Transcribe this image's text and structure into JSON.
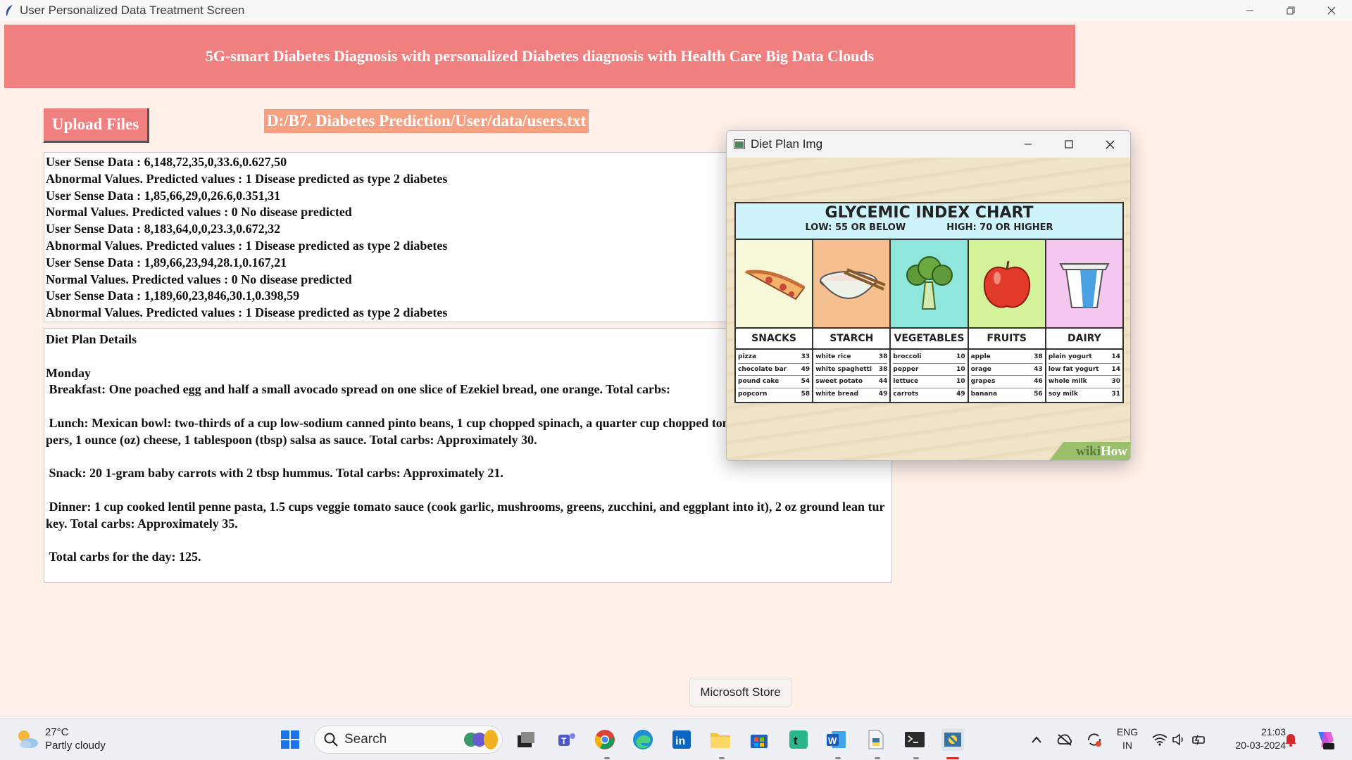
{
  "window": {
    "title": "User Personalized Data Treatment Screen"
  },
  "banner": {
    "title": "5G-smart  Diabetes Diagnosis with personalized Diabetes diagnosis with Health Care Big Data Clouds"
  },
  "upload": {
    "button_label": "Upload Files",
    "file_path": "D:/B7. Diabetes Prediction/User/data/users.txt"
  },
  "results": {
    "lines": [
      "User Sense Data : 6,148,72,35,0,33.6,0.627,50",
      "Abnormal Values. Predicted values : 1 Disease predicted as type 2 diabetes",
      "User Sense Data : 1,85,66,29,0,26.6,0.351,31",
      "Normal Values. Predicted values : 0 No disease predicted",
      "User Sense Data : 8,183,64,0,0,23.3,0.672,32",
      "Abnormal Values. Predicted values : 1 Disease predicted as type 2 diabetes",
      "User Sense Data : 1,89,66,23,94,28.1,0.167,21",
      "Normal Values. Predicted values : 0 No disease predicted",
      "User Sense Data : 1,189,60,23,846,30.1,0.398,59",
      "Abnormal Values. Predicted values : 1 Disease predicted as type 2 diabetes"
    ]
  },
  "diet": {
    "heading": "Diet Plan Details",
    "day": "Monday",
    "breakfast": " Breakfast: One poached egg and half a small avocado spread on one slice of Ezekiel bread, one orange. Total carbs:",
    "lunch": " Lunch: Mexican bowl: two-thirds of a cup low-sodium canned pinto beans, 1 cup chopped spinach, a quarter cup chopped tomatoes, a quarter cup bell peppers, 1 ounce (oz) cheese, 1 tablespoon (tbsp) salsa as sauce. Total carbs: Approximately 30.",
    "snack": " Snack: 20 1-gram baby carrots with 2 tbsp hummus. Total carbs: Approximately 21.",
    "dinner": " Dinner: 1 cup cooked lentil penne pasta, 1.5 cups veggie tomato sauce (cook garlic, mushrooms, greens, zucchini, and eggplant into it), 2 oz ground lean turkey. Total carbs: Approximately 35.",
    "total": " Total carbs for the day: 125."
  },
  "popup": {
    "title": "Diet Plan Img",
    "chart_title": "GLYCEMIC INDEX CHART",
    "low_label": "LOW: 55 OR BELOW",
    "high_label": "HIGH: 70 OR HIGHER",
    "categories": [
      {
        "name": "SNACKS",
        "items": [
          [
            "pizza",
            "33"
          ],
          [
            "chocolate bar",
            "49"
          ],
          [
            "pound cake",
            "54"
          ],
          [
            "popcorn",
            "58"
          ]
        ]
      },
      {
        "name": "STARCH",
        "items": [
          [
            "white rice",
            "38"
          ],
          [
            "white spaghetti",
            "38"
          ],
          [
            "sweet potato",
            "44"
          ],
          [
            "white bread",
            "49"
          ]
        ]
      },
      {
        "name": "VEGETABLES",
        "items": [
          [
            "broccoli",
            "10"
          ],
          [
            "pepper",
            "10"
          ],
          [
            "lettuce",
            "10"
          ],
          [
            "carrots",
            "49"
          ]
        ]
      },
      {
        "name": "FRUITS",
        "items": [
          [
            "apple",
            "38"
          ],
          [
            "orage",
            "43"
          ],
          [
            "grapes",
            "46"
          ],
          [
            "banana",
            "56"
          ]
        ]
      },
      {
        "name": "DAIRY",
        "items": [
          [
            "plain yogurt",
            "14"
          ],
          [
            "low fat yogurt",
            "14"
          ],
          [
            "whole milk",
            "30"
          ],
          [
            "soy milk",
            "31"
          ]
        ]
      }
    ],
    "watermark_wiki": "wiki",
    "watermark_how": "How"
  },
  "tooltip": {
    "text": "Microsoft Store"
  },
  "taskbar": {
    "temperature": "27°C",
    "condition": "Partly cloudy",
    "search_label": "Search",
    "lang_top": "ENG",
    "lang_bottom": "IN",
    "time": "21:03",
    "date": "20-03-2024"
  },
  "colors": {
    "banner": "#f08080",
    "background": "#fff0ea",
    "path_label": "#f5a080"
  }
}
